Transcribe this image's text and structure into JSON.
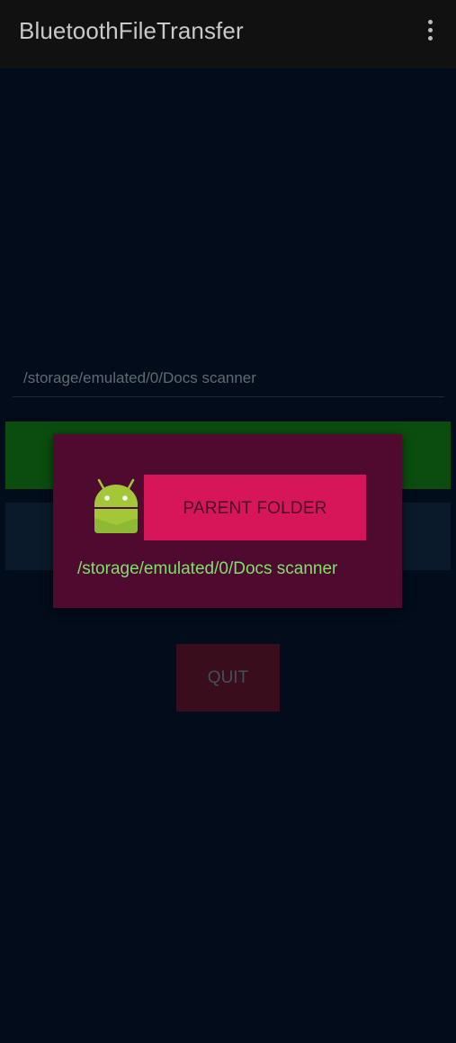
{
  "app_bar": {
    "title": "BluetoothFileTransfer",
    "overflow_icon": "more-vert-icon"
  },
  "path_field": {
    "value": "/storage/emulated/0/Docs scanner"
  },
  "buttons": {
    "quit_label": "QUIT"
  },
  "dialog": {
    "icon": "android-icon",
    "parent_folder_label": "PARENT FOLDER",
    "current_path": "/storage/emulated/0/Docs scanner"
  },
  "colors": {
    "background": "#020c1a",
    "app_bar": "#111111",
    "dialog_background": "#4f0a30",
    "parent_button": "#d61658",
    "path_text": "#7ee06a",
    "green_button": "#0a4d0e",
    "quit_button": "#3a0d1d"
  }
}
